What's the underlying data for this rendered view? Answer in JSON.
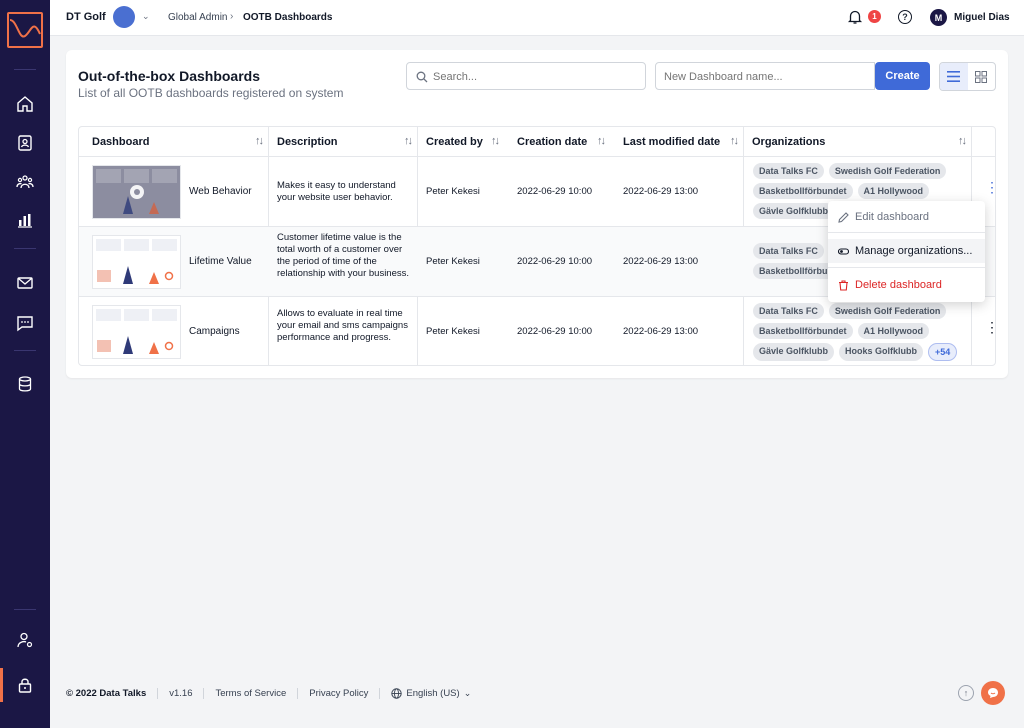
{
  "header": {
    "org_name": "DT Golf",
    "breadcrumb": [
      "Global Admin",
      "OOTB Dashboards"
    ],
    "notification_count": "1",
    "user_initial": "M",
    "user_name": "Miguel Dias"
  },
  "page": {
    "title": "Out-of-the-box Dashboards",
    "subtitle": "List of all OOTB dashboards registered on system",
    "search_placeholder": "Search...",
    "new_name_placeholder": "New Dashboard name...",
    "create_label": "Create"
  },
  "table": {
    "columns": [
      "Dashboard",
      "Description",
      "Created by",
      "Creation date",
      "Last modified date",
      "Organizations"
    ],
    "rows": [
      {
        "name": "Web Behavior",
        "description": "Makes it easy to understand your website user behavior.",
        "created_by": "Peter Kekesi",
        "creation_date": "2022-06-29 10:00",
        "modified_date": "2022-06-29 13:00",
        "orgs": [
          "Data Talks FC",
          "Swedish Golf Federation",
          "Basketbollförbundet",
          "A1 Hollywood",
          "Gävle Golfklubb"
        ]
      },
      {
        "name": "Lifetime Value",
        "description": "Customer lifetime value is the total worth of a customer over the period of time of the relationship with your business.",
        "created_by": "Peter Kekesi",
        "creation_date": "2022-06-29 10:00",
        "modified_date": "2022-06-29 13:00",
        "orgs": [
          "Data Talks FC",
          "Basketbollförbundet"
        ]
      },
      {
        "name": "Campaigns",
        "description": "Allows to evaluate in real time your email and sms campaigns performance and progress.",
        "created_by": "Peter Kekesi",
        "creation_date": "2022-06-29 10:00",
        "modified_date": "2022-06-29 13:00",
        "orgs": [
          "Data Talks FC",
          "Swedish Golf Federation",
          "Basketbollförbundet",
          "A1 Hollywood",
          "Gävle Golfklubb",
          "Hooks Golfklubb"
        ],
        "more": "+54"
      }
    ]
  },
  "menu": {
    "edit": "Edit dashboard",
    "manage": "Manage organizations...",
    "delete": "Delete dashboard"
  },
  "footer": {
    "copyright": "© 2022 Data Talks",
    "version": "v1.16",
    "terms": "Terms of Service",
    "privacy": "Privacy Policy",
    "language": "English (US)"
  },
  "colors": {
    "sidebar": "#1b1745",
    "accent": "#3f6ad8",
    "brand": "#f07148",
    "danger": "#dc2626"
  }
}
